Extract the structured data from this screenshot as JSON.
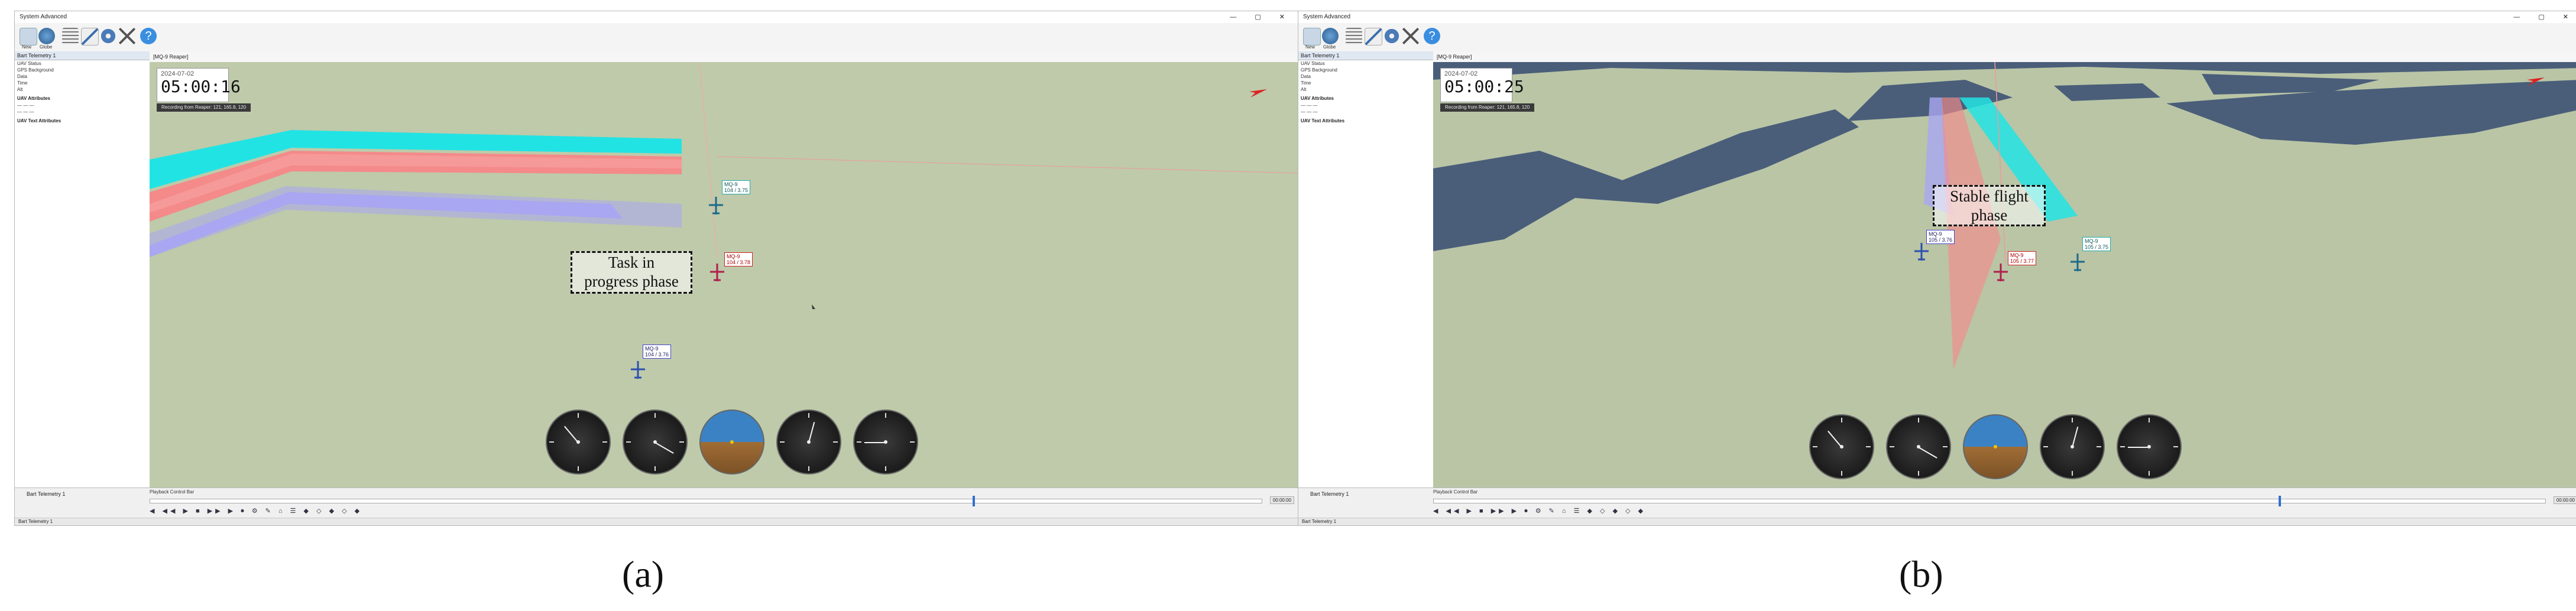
{
  "panels": [
    {
      "id": "a",
      "window_title": "System Advanced",
      "view_title": "[MQ-9 Reaper]",
      "toolbar_labels": [
        "New",
        "Globe",
        "List",
        "Edit",
        "Setup",
        "Tools",
        "Help"
      ],
      "sidebar": {
        "header": "Bart Telemetry 1",
        "rows": [
          "UAV Status",
          "GPS Background",
          "Data",
          "Time",
          "Alt"
        ],
        "sections": [
          "UAV Attributes",
          "UAV Text Attributes"
        ],
        "footer": "Bart Telemetry 1"
      },
      "date": "2024-07-02",
      "clock": "05:00:16",
      "recording_text": "Recording from Reaper: 121, 165.8, 120",
      "phase_text": [
        "Task in",
        "progress phase"
      ],
      "aircraft": [
        {
          "label": [
            "MQ-9",
            "104 / 3.75"
          ],
          "color": "cyan"
        },
        {
          "label": [
            "MQ-9",
            "104 / 3.78"
          ],
          "color": "red"
        },
        {
          "label": [
            "MQ-9",
            "104 / 3.76"
          ],
          "color": "blue"
        }
      ],
      "playback_title": "Playback Control Bar",
      "playback_time": "00:00:00",
      "status_text": "Bart Telemetry 1",
      "caption": "(a)"
    },
    {
      "id": "b",
      "window_title": "System Advanced",
      "view_title": "[MQ-9 Reaper]",
      "toolbar_labels": [
        "New",
        "Globe",
        "List",
        "Edit",
        "Setup",
        "Tools",
        "Help"
      ],
      "sidebar": {
        "header": "Bart Telemetry 1",
        "rows": [
          "UAV Status",
          "GPS Background",
          "Data",
          "Time",
          "Alt"
        ],
        "sections": [
          "UAV Attributes",
          "UAV Text Attributes"
        ],
        "footer": "Bart Telemetry 1"
      },
      "date": "2024-07-02",
      "clock": "05:00:25",
      "recording_text": "Recording from Reaper: 121, 165.8, 120",
      "phase_text": [
        "Stable flight",
        "phase"
      ],
      "aircraft": [
        {
          "label": [
            "MQ-9",
            "105 / 3.76"
          ],
          "color": "blue"
        },
        {
          "label": [
            "MQ-9",
            "105 / 3.77"
          ],
          "color": "red"
        },
        {
          "label": [
            "MQ-9",
            "105 / 3.75"
          ],
          "color": "cyan"
        }
      ],
      "playback_title": "Playback Control Bar",
      "playback_time": "00:00:00",
      "status_text": "Bart Telemetry 1",
      "caption": "(b)"
    }
  ],
  "colors": {
    "cyan_trail": "#22e3e3",
    "red_trail": "#f48a8a",
    "blue_trail": "#a9a6f2",
    "terrain": "#b9c5a5",
    "water": "#4a5e7a",
    "accent": "#2f6fd1"
  },
  "icons": [
    "new-icon",
    "globe-icon",
    "list-icon",
    "edit-icon",
    "gear-icon",
    "tools-icon",
    "help-icon",
    "aircraft-icon",
    "gauge-icon"
  ]
}
